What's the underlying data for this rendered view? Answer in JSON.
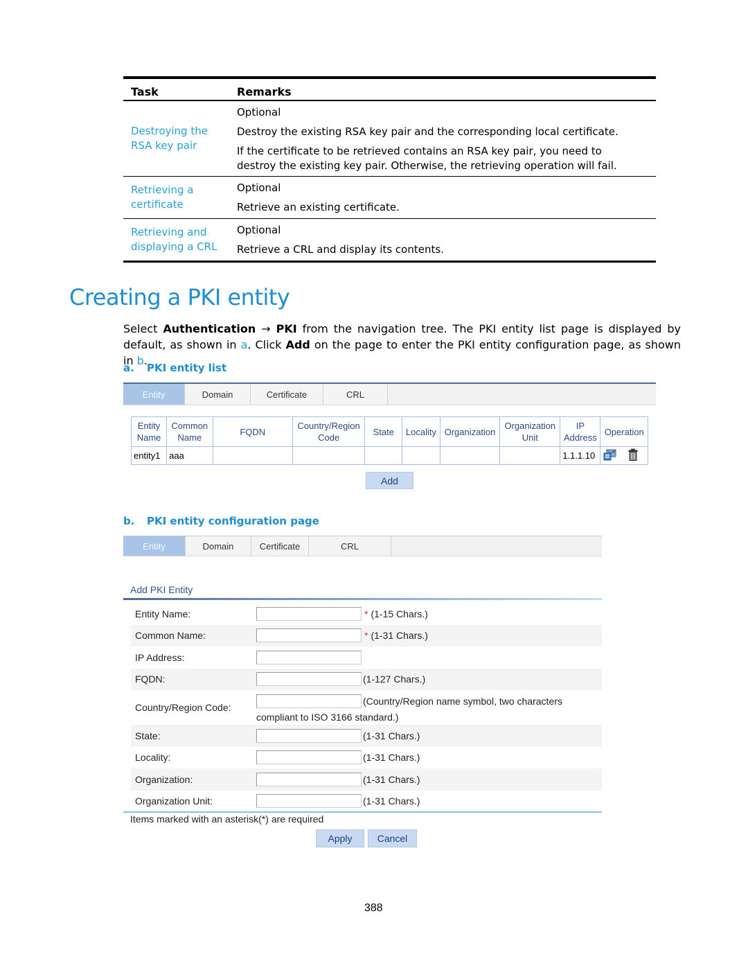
{
  "task_table": {
    "headers": {
      "task": "Task",
      "remarks": "Remarks"
    },
    "rows": [
      {
        "task": "Destroying the RSA key pair",
        "remarks": [
          "Optional",
          "Destroy the existing RSA key pair and the corresponding local certificate.",
          "If the certificate to be retrieved contains an RSA key pair, you need to destroy the existing key pair. Otherwise, the retrieving operation will fail."
        ]
      },
      {
        "task": "Retrieving a certificate",
        "remarks": [
          "Optional",
          "Retrieve an existing certificate."
        ]
      },
      {
        "task": "Retrieving and displaying a CRL",
        "remarks": [
          "Optional",
          "Retrieve a CRL and display its contents."
        ]
      }
    ]
  },
  "section": {
    "title": "Creating a PKI entity",
    "para": {
      "t1": "Select ",
      "b1": "Authentication",
      "arrow": " → ",
      "b2": "PKI",
      "t2": " from the navigation tree. The PKI entity list page is displayed by default, as shown in ",
      "ref_a": "a",
      "t3": ". Click ",
      "b3": "Add",
      "t4": " on the page to enter the PKI entity configuration page, as shown in ",
      "ref_b": "b",
      "t5": "."
    }
  },
  "figure_a": {
    "letter": "a.",
    "caption": "PKI entity list",
    "tabs": [
      "Entity",
      "Domain",
      "Certificate",
      "CRL"
    ],
    "active_tab": "Entity",
    "columns": [
      "Entity Name",
      "Common Name",
      "FQDN",
      "Country/Region Code",
      "State",
      "Locality",
      "Organization",
      "Organization Unit",
      "IP Address",
      "Operation"
    ],
    "rows": [
      {
        "entity_name": "entity1",
        "common_name": "aaa",
        "fqdn": "",
        "country": "",
        "state": "",
        "locality": "",
        "organization": "",
        "org_unit": "",
        "ip": "1.1.1.10",
        "operations": [
          "details-icon",
          "delete-icon"
        ]
      }
    ],
    "add_button": "Add"
  },
  "figure_b": {
    "letter": "b.",
    "caption": "PKI entity configuration page",
    "tabs": [
      "Entity",
      "Domain",
      "Certificate",
      "CRL"
    ],
    "active_tab": "Entity",
    "form_title": "Add PKI Entity",
    "fields": [
      {
        "label": "Entity Name:",
        "value": "",
        "required": "*",
        "hint": "(1-15 Chars.)"
      },
      {
        "label": "Common Name:",
        "value": "",
        "required": "*",
        "hint": "(1-31 Chars.)"
      },
      {
        "label": "IP Address:",
        "value": "",
        "required": "",
        "hint": ""
      },
      {
        "label": "FQDN:",
        "value": "",
        "required": "",
        "hint": "(1-127 Chars.)"
      },
      {
        "label": "Country/Region Code:",
        "value": "",
        "required": "",
        "hint": "(Country/Region name symbol, two characters",
        "hint2": "compliant to ISO 3166 standard.)"
      },
      {
        "label": "State:",
        "value": "",
        "required": "",
        "hint": "(1-31 Chars.)"
      },
      {
        "label": "Locality:",
        "value": "",
        "required": "",
        "hint": "(1-31 Chars.)"
      },
      {
        "label": "Organization:",
        "value": "",
        "required": "",
        "hint": "(1-31 Chars.)"
      },
      {
        "label": "Organization Unit:",
        "value": "",
        "required": "",
        "hint": "(1-31 Chars.)"
      }
    ],
    "note": "Items marked with an asterisk(*) are required",
    "apply_button": "Apply",
    "cancel_button": "Cancel"
  },
  "page_number": "388"
}
